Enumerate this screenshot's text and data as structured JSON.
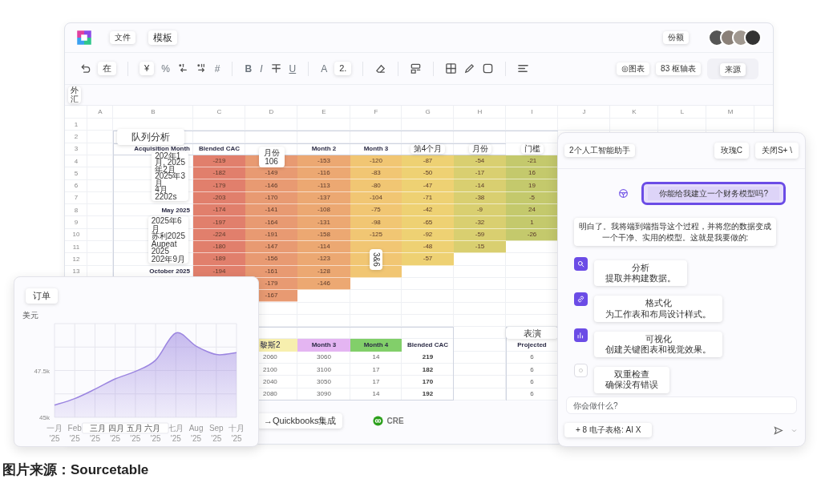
{
  "app": {
    "file_menu": "文件",
    "template_tab": "模板",
    "share_button": "份额"
  },
  "toolbar": {
    "texts": [
      "在",
      "¥",
      "%",
      "#",
      "B",
      "I",
      "U",
      "A",
      "2."
    ],
    "buttons": [
      "◎图表",
      "83 枢轴表"
    ],
    "source_button": "来源"
  },
  "formula_bar": {
    "cell_ref": "外汇"
  },
  "sheet": {
    "column_letters": [
      "A",
      "B",
      "C",
      "D",
      "E",
      "F",
      "G",
      "H",
      "I",
      "J",
      "K",
      "L",
      "M"
    ],
    "row_numbers": [
      "1",
      "2",
      "3",
      "4",
      "5",
      "6",
      "7",
      "8",
      "9",
      "10",
      "11",
      "12",
      "13"
    ]
  },
  "cohort": {
    "title": "队列分析",
    "row_header": "Acquisition Month",
    "columns": [
      {
        "text": "Blended CAC",
        "kind": "plain"
      },
      null,
      {
        "text": "Month 2",
        "kind": "plain"
      },
      {
        "text": "Month 3",
        "kind": "plain"
      },
      {
        "text": "第4个月",
        "kind": "chip"
      },
      {
        "text": "月份",
        "kind": "chip"
      },
      {
        "text": "门槛",
        "kind": "chip"
      }
    ],
    "rows": [
      {
        "cells": [
          "-219",
          null,
          "-153",
          "-120",
          "-87",
          "-54",
          "-21"
        ]
      },
      {
        "cells": [
          "-182",
          "-149",
          "-116",
          "-83",
          "-50",
          "-17",
          "16"
        ]
      },
      {
        "cells": [
          "-179",
          "-146",
          "-113",
          "-80",
          "-47",
          "-14",
          "19"
        ]
      },
      {
        "cells": [
          "-203",
          "-170",
          "-137",
          "-104",
          "-71",
          "-38",
          "-5"
        ]
      },
      {
        "label": "May 2025",
        "cells": [
          "-174",
          "-141",
          "-108",
          "-75",
          "-42",
          "-9",
          "24"
        ]
      },
      {
        "cells": [
          "-197",
          "-164",
          "-131",
          "-98",
          "-65",
          "-32",
          "1"
        ]
      },
      {
        "cells": [
          "-224",
          "-191",
          "-158",
          "-125",
          "-92",
          "-59",
          "-26"
        ]
      },
      {
        "cells": [
          "-180",
          "-147",
          "-114",
          null,
          "-48",
          "-15"
        ]
      },
      {
        "cells": [
          "-189",
          "-156",
          "-123",
          null,
          "-57"
        ]
      },
      {
        "label": "October 2025",
        "cells": [
          "-194",
          "-161",
          "-128",
          null
        ]
      },
      {
        "cells": [
          null,
          "-179",
          "-146"
        ]
      },
      {
        "cells": [
          null,
          "-167"
        ]
      }
    ],
    "notes": [
      {
        "lines": [
          "202年1",
          "月, 2025",
          "年2月",
          "2025年3",
          "月",
          "4月",
          "2202s"
        ]
      },
      {
        "lines": [
          "2025年6",
          "月",
          "苏利2025",
          "Aupeat",
          "2025",
          "202年9月"
        ]
      }
    ],
    "value_popup": {
      "lines": [
        "月份",
        "106"
      ]
    },
    "side_label": "3&6"
  },
  "revenue_table": {
    "columns": [
      {
        "text": "黎斯2",
        "color": "#f7efae"
      },
      {
        "text": "Month 3",
        "color": "#e4b5f2"
      },
      {
        "text": "Month 4",
        "color": "#82cf6a"
      },
      {
        "text": "Blended CAC",
        "color": "#ffffff"
      }
    ],
    "rows": [
      [
        "2060",
        "3060",
        "14",
        "219"
      ],
      [
        "2100",
        "3100",
        "17",
        "182"
      ],
      [
        "2040",
        "3050",
        "17",
        "170"
      ],
      [
        "2080",
        "3090",
        "14",
        "192"
      ]
    ]
  },
  "projection": {
    "title": "表演",
    "column": "Projected",
    "values": [
      "6",
      "6",
      "6",
      "6"
    ]
  },
  "footer": {
    "integration_button": "→Quickbooks集成",
    "brand": "CRE"
  },
  "orders_card": {
    "title": "订单",
    "unit": "美元",
    "chart_data": {
      "type": "area",
      "categories": [
        "一月 '25",
        "Feb '25",
        "'25",
        "'25",
        "'25",
        "'25",
        "七月 '25",
        "Aug '25",
        "Sep '25",
        "十月 '25"
      ],
      "grid": true,
      "series": [
        {
          "color": "#9b85e0",
          "values": [
            45650,
            46000,
            46500,
            47050,
            47450,
            48050,
            49500,
            48800,
            48350,
            48450
          ]
        }
      ],
      "ylim": [
        45000,
        50000
      ],
      "yticks": [
        {
          "value": 45000,
          "label": "45k"
        },
        {
          "value": 47500,
          "label": "47.5k"
        }
      ],
      "annotations": [
        "三月 四月 五月 六月"
      ]
    }
  },
  "assistant": {
    "title": "2个人工智能助手",
    "header_buttons": [
      "玫瑰C",
      "关闭S+ \\"
    ],
    "user_message": "你能给我建立一个财务模型吗?",
    "reply": "明白了。我将端到端指导这个过程，并将您的数据变成一个干净、实用的模型。这就是我要做的:",
    "steps": [
      {
        "title": "分析",
        "desc": "提取并构建数据。",
        "done": true
      },
      {
        "title": "格式化",
        "desc": "为工作表和布局设计样式。",
        "done": true
      },
      {
        "title": "可视化",
        "desc": "创建关键图表和视觉效果。",
        "done": true
      },
      {
        "title": "双重检查",
        "desc": "确保没有错误",
        "done": false
      }
    ],
    "input": {
      "placeholder": "你会做什么?"
    },
    "context_button": "+ 8 电子表格: AI X"
  },
  "caption": {
    "label": "图片来源：",
    "source": "Sourcetable"
  }
}
